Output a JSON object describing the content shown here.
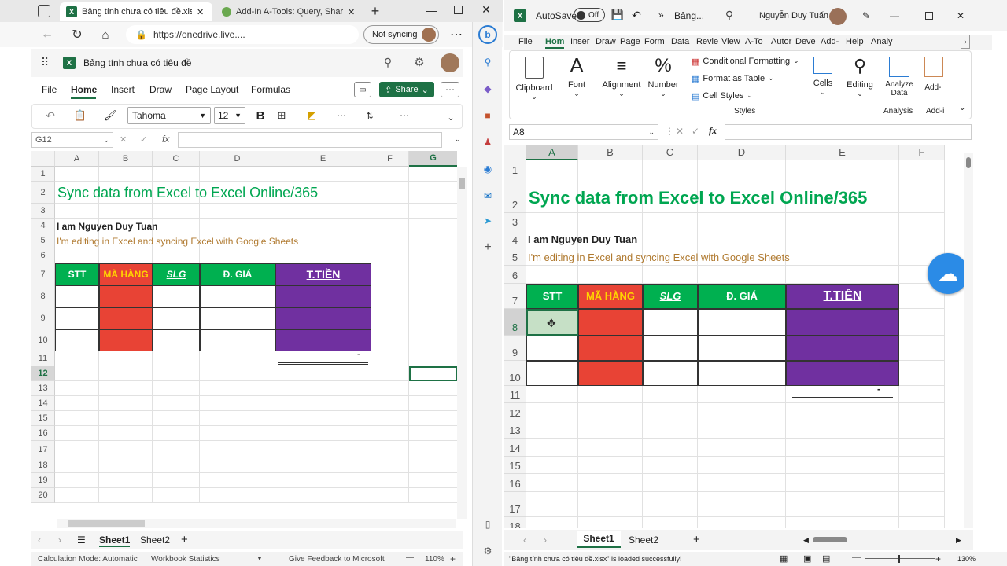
{
  "left": {
    "tabs": [
      {
        "label": "Bảng tính chưa có tiêu đề.xlsx",
        "close": "✕"
      },
      {
        "label": "Add-In A-Tools: Query, Share E",
        "close": "✕"
      }
    ],
    "address": "https://onedrive.live....",
    "sync_label": "Not syncing",
    "app_title": "Bảng tính chưa có tiêu đề",
    "menu": [
      "File",
      "Home",
      "Insert",
      "Draw",
      "Page Layout",
      "Formulas"
    ],
    "share_label": "Share",
    "font_name": "Tahoma",
    "font_size": "12",
    "bold": "B",
    "namebox": "G12",
    "fx": "fx",
    "columns": [
      "A",
      "B",
      "C",
      "D",
      "E",
      "F",
      "G"
    ],
    "rows": [
      "1",
      "2",
      "3",
      "4",
      "5",
      "6",
      "7",
      "8",
      "9",
      "10",
      "11",
      "12",
      "13",
      "14",
      "15",
      "16",
      "17",
      "18",
      "19",
      "20"
    ],
    "sheet": {
      "title": "Sync data from Excel to Excel Online/365",
      "author": "I am Nguyen Duy Tuan",
      "subtitle": "I'm editing in Excel and syncing Excel with Google Sheets",
      "headers": [
        "STT",
        "MÃ HÀNG",
        "SLG",
        "Đ. GIÁ",
        "T.TIỀN"
      ],
      "total": "-"
    },
    "sheet_tabs": [
      "Sheet1",
      "Sheet2"
    ],
    "status": {
      "calc": "Calculation Mode: Automatic",
      "stats": "Workbook Statistics",
      "feedback": "Give Feedback to Microsoft",
      "zoom": "110%",
      "minus": "—",
      "plus": "+"
    }
  },
  "right": {
    "autosave": "AutoSave",
    "toggle": "Off",
    "filename": "Bảng...",
    "user": "Nguyễn Duy Tuấn",
    "menu": [
      "File",
      "Hom",
      "Inser",
      "Draw",
      "Page",
      "Form",
      "Data",
      "Revie",
      "View",
      "A-To",
      "Autor",
      "Deve",
      "Add-",
      "Help",
      "Analy"
    ],
    "ribbon": {
      "clipboard": "Clipboard",
      "font": "Font",
      "alignment": "Alignment",
      "number": "Number",
      "cond_format": "Conditional Formatting",
      "format_table": "Format as Table",
      "cell_styles": "Cell Styles",
      "styles": "Styles",
      "cells": "Cells",
      "editing": "Editing",
      "analyze_line1": "Analyze",
      "analyze_line2": "Data",
      "analysis": "Analysis",
      "addins": "Add-i",
      "addins2": "Add-i"
    },
    "namebox": "A8",
    "fx": "fx",
    "columns": [
      "A",
      "B",
      "C",
      "D",
      "E",
      "F"
    ],
    "rows": [
      "1",
      "2",
      "3",
      "4",
      "5",
      "6",
      "7",
      "8",
      "9",
      "10",
      "11",
      "12",
      "13",
      "14",
      "15",
      "16",
      "17",
      "18"
    ],
    "sheet": {
      "title": "Sync data from Excel to Excel Online/365",
      "author": "I am Nguyen Duy Tuan",
      "subtitle": "I'm editing in Excel and syncing Excel with Google Sheets",
      "headers": [
        "STT",
        "MÃ HÀNG",
        "SLG",
        "Đ. GIÁ",
        "T.TIỀN"
      ],
      "total": "-"
    },
    "sheet_tabs": [
      "Sheet1",
      "Sheet2"
    ],
    "status": {
      "message": "\"Bảng tính chưa có tiêu đề.xlsx\" is loaded successfully!",
      "zoom": "130%",
      "plus": "+"
    }
  },
  "colors": {
    "green_header": "#00b050",
    "red_fill": "#e84335",
    "purple_fill": "#7030a0",
    "title_green": "#00a651",
    "subtitle_brown": "#b07a30",
    "excel_green": "#1e7145"
  }
}
